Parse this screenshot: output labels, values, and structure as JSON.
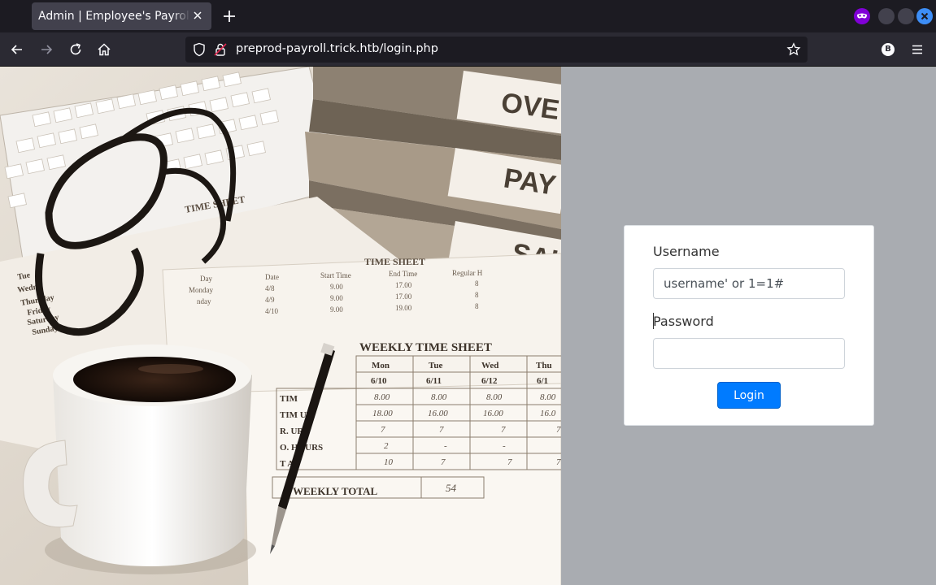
{
  "browser": {
    "tab_title": "Admin | Employee's Payroll Management System",
    "url_host": "preprod-payroll.trick.htb",
    "url_path": "/login.php",
    "profile_initial": "B"
  },
  "hero_image": {
    "folder_tabs": [
      "OVE",
      "PAY",
      "SAL"
    ],
    "sheet_titles": [
      "TIME SHEET",
      "TIME SHEET",
      "WEEKLY TIME SHEET"
    ],
    "weekly_headers": [
      "Mon",
      "Tue",
      "Wed",
      "Thu"
    ],
    "weekly_dates": [
      "6/10",
      "6/11",
      "6/12",
      "6/1"
    ],
    "time_in": [
      "8.00",
      "8.00",
      "8.00",
      "8.00"
    ],
    "time_out": [
      "18.00",
      "16.00",
      "16.00",
      "16.0"
    ],
    "reg_hours": [
      "7",
      "7",
      "7",
      "7"
    ],
    "ot_hours": [
      "2",
      "-",
      "-",
      ""
    ],
    "totals": [
      "10",
      "7",
      "7",
      "7"
    ],
    "row_labels": [
      "TIM",
      "TIM  UT",
      "R.    URS",
      "O.   HOURS",
      "T   AL"
    ],
    "weekly_total_label": "WEEKLY TOTAL",
    "weekly_total_value": "54",
    "days": [
      "Tue",
      "Wedne",
      "Thursday",
      "Friday",
      "Saturday",
      "Sunday"
    ],
    "mid_headers": [
      "Day",
      "Date",
      "Start Time",
      "End Time",
      "Regular H"
    ],
    "mid_rows": [
      [
        "Monday",
        "4/8",
        "9.00",
        "17.00",
        "8"
      ],
      [
        "nday",
        "4/9",
        "9.00",
        "17.00",
        "8"
      ],
      [
        "",
        "4/10",
        "9.00",
        "19.00",
        "8"
      ]
    ]
  },
  "login": {
    "username_label": "Username",
    "username_value": "username' or 1=1#",
    "password_label": "Password",
    "password_value": "",
    "button_label": "Login"
  },
  "colors": {
    "accent": "#007bff",
    "page_bg": "#a9acb1",
    "chrome_bg": "#1c1b22",
    "toolbar_bg": "#2b2a33"
  }
}
